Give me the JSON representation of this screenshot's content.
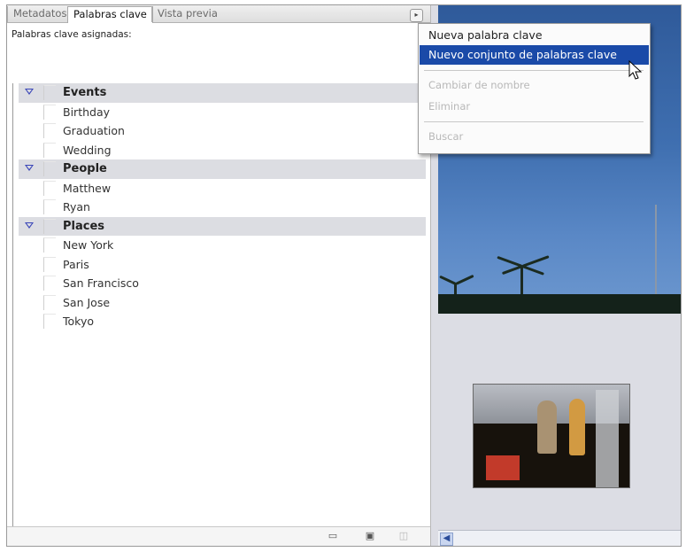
{
  "tabs": [
    {
      "label": "Metadatos",
      "active": false
    },
    {
      "label": "Palabras clave",
      "active": true
    },
    {
      "label": "Vista previa",
      "active": false
    }
  ],
  "panel_menu_icon": "circle-arrow-icon",
  "assigned_keywords_label": "Palabras clave asignadas:",
  "keyword_groups": [
    {
      "label": "Events",
      "expanded": true,
      "keywords": [
        "Birthday",
        "Graduation",
        "Wedding"
      ]
    },
    {
      "label": "People",
      "expanded": true,
      "keywords": [
        "Matthew",
        "Ryan"
      ]
    },
    {
      "label": "Places",
      "expanded": true,
      "keywords": [
        "New York",
        "Paris",
        "San Francisco",
        "San Jose",
        "Tokyo"
      ]
    }
  ],
  "bottom_toolbar_icons": [
    "new-keyword-set-icon",
    "new-keyword-icon",
    "delete-icon"
  ],
  "context_menu": {
    "items": [
      {
        "label": "Nueva palabra clave",
        "state": "normal"
      },
      {
        "label": "Nuevo conjunto de palabras clave",
        "state": "selected"
      },
      {
        "label": "Cambiar de nombre",
        "state": "disabled"
      },
      {
        "label": "Eliminar",
        "state": "disabled"
      },
      {
        "label": "Buscar",
        "state": "disabled"
      }
    ]
  },
  "colors": {
    "menu_highlight": "#1a4aa8",
    "group_row_bg": "#dcdde2",
    "expand_triangle": "#3a46b8"
  }
}
